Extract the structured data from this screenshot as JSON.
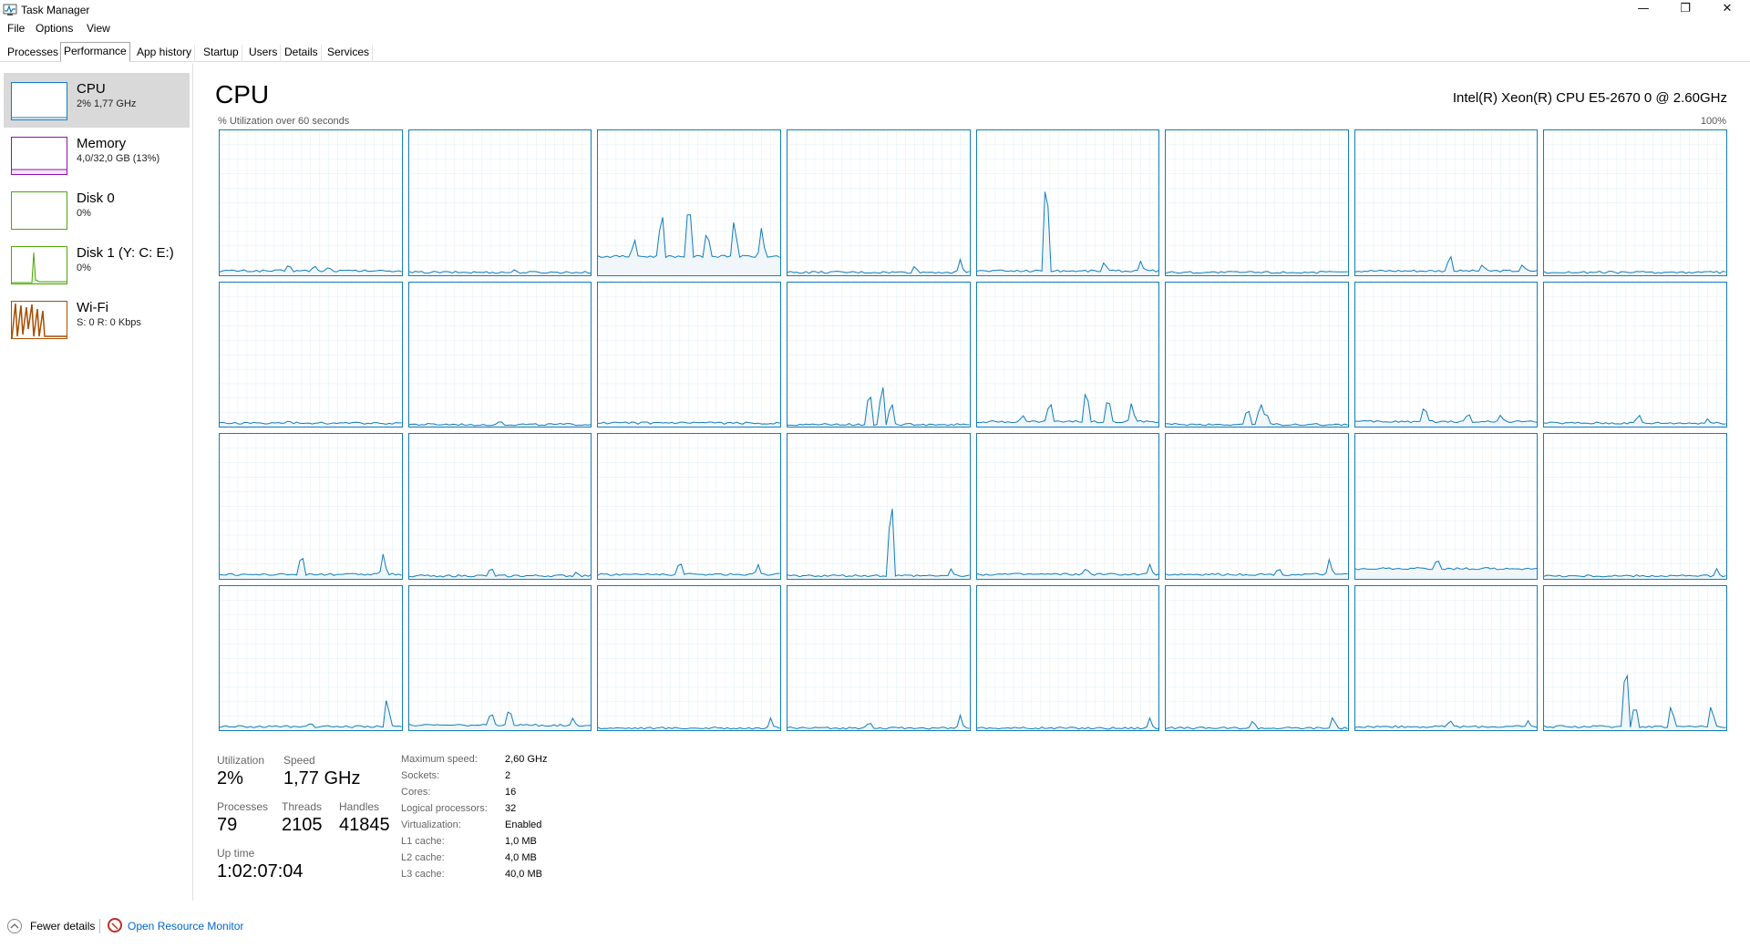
{
  "window": {
    "title": "Task Manager",
    "minimize_glyph": "—",
    "restore_glyph": "❐",
    "close_glyph": "✕"
  },
  "menu": [
    "File",
    "Options",
    "View"
  ],
  "tabs": [
    "Processes",
    "Performance",
    "App history",
    "Startup",
    "Users",
    "Details",
    "Services"
  ],
  "active_tab": "Performance",
  "sidebar": {
    "items": [
      {
        "name": "CPU",
        "sub": "2% 1,77 GHz",
        "color": "#117dbb"
      },
      {
        "name": "Memory",
        "sub": "4,0/32,0 GB (13%)",
        "color": "#8b12ae"
      },
      {
        "name": "Disk 0",
        "sub": "0%",
        "color": "#4da60c"
      },
      {
        "name": "Disk 1 (Y: C: E:)",
        "sub": "0%",
        "color": "#4da60c"
      },
      {
        "name": "Wi-Fi",
        "sub": "S: 0 R: 0 Kbps",
        "color": "#a74f01"
      }
    ]
  },
  "main": {
    "title": "CPU",
    "model": "Intel(R) Xeon(R) CPU E5-2670 0 @ 2.60GHz",
    "graph_caption": "% Utilization over 60 seconds",
    "graph_max": "100%",
    "line_color": "#117dbb",
    "fill_color": "#f1f6fa",
    "grid_color": "#d9eaf4"
  },
  "stats": {
    "utilization": {
      "label": "Utilization",
      "value": "2%"
    },
    "speed": {
      "label": "Speed",
      "value": "1,77 GHz"
    },
    "processes": {
      "label": "Processes",
      "value": "79"
    },
    "threads": {
      "label": "Threads",
      "value": "2105"
    },
    "handles": {
      "label": "Handles",
      "value": "41845"
    },
    "uptime": {
      "label": "Up time",
      "value": "1:02:07:04"
    }
  },
  "specs": [
    {
      "key": "Maximum speed:",
      "value": "2,60 GHz"
    },
    {
      "key": "Sockets:",
      "value": "2"
    },
    {
      "key": "Cores:",
      "value": "16"
    },
    {
      "key": "Logical processors:",
      "value": "32"
    },
    {
      "key": "Virtualization:",
      "value": "Enabled"
    },
    {
      "key": "L1 cache:",
      "value": "1,0 MB"
    },
    {
      "key": "L2 cache:",
      "value": "4,0 MB"
    },
    {
      "key": "L3 cache:",
      "value": "40,0 MB"
    }
  ],
  "footer": {
    "fewer": "Fewer details",
    "resource_monitor": "Open Resource Monitor"
  },
  "cpu_graphs": {
    "points_per_graph": 60,
    "logical_processors": [
      {
        "base": 2,
        "spikes": [
          [
            38,
            6
          ],
          [
            52,
            5
          ],
          [
            60,
            4
          ]
        ]
      },
      {
        "base": 1,
        "spikes": [
          [
            58,
            3
          ]
        ]
      },
      {
        "base": 12,
        "spikes": [
          [
            35,
            38
          ],
          [
            50,
            48
          ],
          [
            60,
            22
          ],
          [
            75,
            30
          ],
          [
            90,
            22
          ],
          [
            20,
            14
          ]
        ]
      },
      {
        "base": 1,
        "spikes": [
          [
            70,
            6
          ],
          [
            95,
            10
          ]
        ]
      },
      {
        "base": 2,
        "spikes": [
          [
            38,
            82
          ],
          [
            70,
            8
          ],
          [
            90,
            8
          ]
        ]
      },
      {
        "base": 1,
        "spikes": []
      },
      {
        "base": 2,
        "spikes": [
          [
            52,
            14
          ],
          [
            70,
            6
          ],
          [
            92,
            6
          ]
        ]
      },
      {
        "base": 1,
        "spikes": []
      },
      {
        "base": 2,
        "spikes": [
          [
            38,
            3
          ]
        ]
      },
      {
        "base": 1,
        "spikes": [
          [
            50,
            4
          ]
        ]
      },
      {
        "base": 2,
        "spikes": []
      },
      {
        "base": 1,
        "spikes": [
          [
            45,
            30
          ],
          [
            52,
            35
          ],
          [
            57,
            20
          ]
        ]
      },
      {
        "base": 3,
        "spikes": [
          [
            40,
            18
          ],
          [
            60,
            28
          ],
          [
            72,
            22
          ],
          [
            85,
            15
          ],
          [
            25,
            6
          ]
        ]
      },
      {
        "base": 1,
        "spikes": [
          [
            45,
            15
          ],
          [
            52,
            19
          ],
          [
            55,
            12
          ]
        ]
      },
      {
        "base": 3,
        "spikes": [
          [
            38,
            14
          ],
          [
            62,
            8
          ],
          [
            80,
            6
          ]
        ]
      },
      {
        "base": 2,
        "spikes": [
          [
            52,
            8
          ],
          [
            90,
            4
          ]
        ]
      },
      {
        "base": 2,
        "spikes": [
          [
            45,
            18
          ],
          [
            90,
            16
          ]
        ]
      },
      {
        "base": 1,
        "spikes": [
          [
            45,
            8
          ],
          [
            92,
            4
          ]
        ]
      },
      {
        "base": 2,
        "spikes": [
          [
            45,
            12
          ],
          [
            88,
            8
          ]
        ]
      },
      {
        "base": 1,
        "spikes": [
          [
            57,
            66
          ],
          [
            90,
            6
          ]
        ]
      },
      {
        "base": 2,
        "spikes": [
          [
            60,
            6
          ],
          [
            95,
            8
          ]
        ]
      },
      {
        "base": 2,
        "spikes": [
          [
            62,
            6
          ],
          [
            90,
            12
          ]
        ]
      },
      {
        "base": 6,
        "spikes": [
          [
            45,
            9
          ]
        ]
      },
      {
        "base": 1,
        "spikes": [
          [
            95,
            6
          ]
        ]
      },
      {
        "base": 2,
        "spikes": [
          [
            92,
            24
          ],
          [
            50,
            4
          ]
        ]
      },
      {
        "base": 3,
        "spikes": [
          [
            45,
            12
          ],
          [
            55,
            15
          ],
          [
            90,
            6
          ]
        ]
      },
      {
        "base": 1,
        "spikes": [
          [
            95,
            8
          ]
        ]
      },
      {
        "base": 1,
        "spikes": [
          [
            45,
            6
          ],
          [
            95,
            10
          ]
        ]
      },
      {
        "base": 1,
        "spikes": [
          [
            95,
            8
          ]
        ]
      },
      {
        "base": 1,
        "spikes": [
          [
            48,
            7
          ],
          [
            92,
            10
          ]
        ]
      },
      {
        "base": 2,
        "spikes": [
          [
            52,
            6
          ],
          [
            95,
            5
          ]
        ]
      },
      {
        "base": 2,
        "spikes": [
          [
            45,
            55
          ],
          [
            50,
            20
          ],
          [
            70,
            18
          ],
          [
            92,
            18
          ]
        ]
      }
    ]
  }
}
